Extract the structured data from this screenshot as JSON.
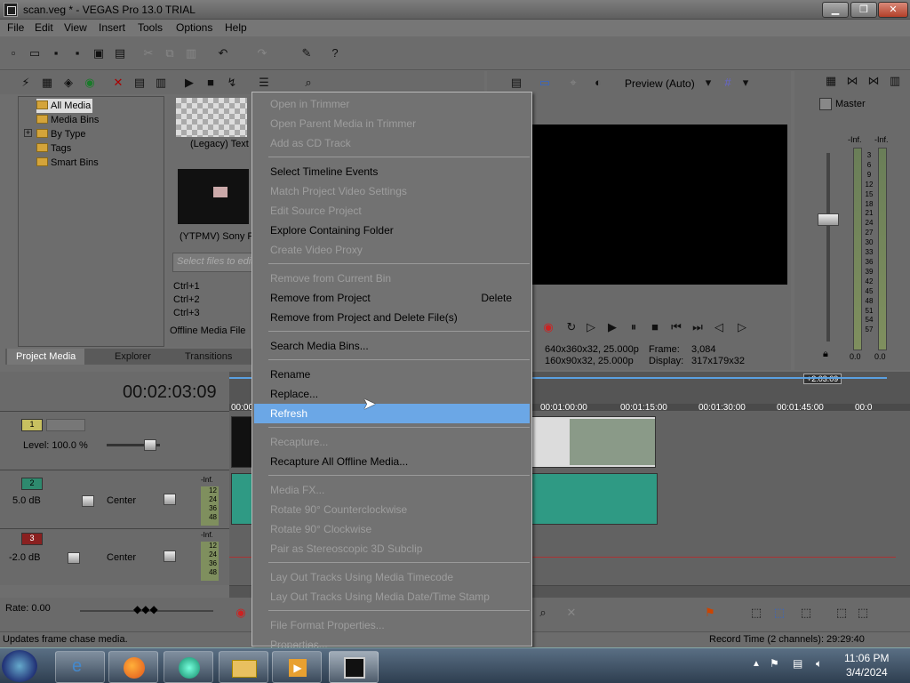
{
  "window": {
    "title": "scan.veg * - VEGAS Pro 13.0 TRIAL",
    "minimize": "▁",
    "maximize": "❐",
    "close": "✕"
  },
  "menu": [
    "File",
    "Edit",
    "View",
    "Insert",
    "Tools",
    "Options",
    "Help"
  ],
  "media_tree": {
    "items": [
      "All Media",
      "Media Bins",
      "By Type",
      "Tags",
      "Smart Bins"
    ],
    "expand": "+"
  },
  "media_thumbs": {
    "legacy_text": "(Legacy) Text",
    "ytpmv": "(YTPMV) Sony Pic",
    "search_placeholder": "Select files to edit",
    "shortcuts": [
      "Ctrl+1",
      "Ctrl+2",
      "Ctrl+3"
    ],
    "offline": "Offline Media File"
  },
  "tabs": [
    "Project Media",
    "Explorer",
    "Transitions"
  ],
  "preview": {
    "mode": "Preview (Auto)",
    "info_project": "640x360x32, 25.000p",
    "info_preview": "160x90x32, 25.000p",
    "frame_label": "Frame:",
    "frame_value": "3,084",
    "display_label": "Display:",
    "display_value": "317x179x32"
  },
  "master": {
    "label": "Master",
    "inf_l": "-Inf.",
    "inf_r": "-Inf.",
    "scale": [
      "3",
      "6",
      "9",
      "12",
      "15",
      "18",
      "21",
      "24",
      "27",
      "30",
      "33",
      "36",
      "39",
      "42",
      "45",
      "48",
      "51",
      "54",
      "57"
    ],
    "bottom_l": "0.0",
    "bottom_r": "0.0"
  },
  "timeline": {
    "timecode": "00:02:03:09",
    "marker": "+2:03:09",
    "ruler": [
      "00:00:00",
      "00:01:00:00",
      "00:01:15:00",
      "00:01:30:00",
      "00:01:45:00",
      "00:0"
    ]
  },
  "tracks": [
    {
      "num": "1",
      "level": "Level: 100.0 %"
    },
    {
      "num": "2",
      "vol": "5.0 dB",
      "pan": "Center",
      "inf": "-Inf.",
      "scale": [
        "12",
        "24",
        "36",
        "48"
      ]
    },
    {
      "num": "3",
      "vol": "-2.0 dB",
      "pan": "Center",
      "inf": "-Inf.",
      "scale": [
        "12",
        "24",
        "36",
        "48"
      ]
    }
  ],
  "rate": "Rate: 0.00",
  "status": {
    "left": "Updates frame chase media.",
    "right": "Record Time (2 channels): 29:29:40"
  },
  "context_menu": {
    "items": [
      {
        "label": "Open in Trimmer",
        "disabled": true
      },
      {
        "label": "Open Parent Media in Trimmer",
        "disabled": true
      },
      {
        "label": "Add as CD Track",
        "disabled": true
      },
      {
        "label": "Select Timeline Events",
        "disabled": false
      },
      {
        "label": "Match Project Video Settings",
        "disabled": true
      },
      {
        "label": "Edit Source Project",
        "disabled": true
      },
      {
        "label": "Explore Containing Folder",
        "disabled": false
      },
      {
        "label": "Create Video Proxy",
        "disabled": true
      },
      {
        "label": "Remove from Current Bin",
        "disabled": true
      },
      {
        "label": "Remove from Project",
        "disabled": false,
        "shortcut": "Delete"
      },
      {
        "label": "Remove from Project and Delete File(s)",
        "disabled": false
      },
      {
        "label": "Search Media Bins...",
        "disabled": false
      },
      {
        "label": "Rename",
        "disabled": false
      },
      {
        "label": "Replace...",
        "disabled": false
      },
      {
        "label": "Refresh",
        "disabled": false,
        "highlighted": true
      },
      {
        "label": "Recapture...",
        "disabled": true
      },
      {
        "label": "Recapture All Offline Media...",
        "disabled": false
      },
      {
        "label": "Media FX...",
        "disabled": true
      },
      {
        "label": "Rotate 90° Counterclockwise",
        "disabled": true
      },
      {
        "label": "Rotate 90° Clockwise",
        "disabled": true
      },
      {
        "label": "Pair as Stereoscopic 3D Subclip",
        "disabled": true
      },
      {
        "label": "Lay Out Tracks Using Media Timecode",
        "disabled": true
      },
      {
        "label": "Lay Out Tracks Using Media Date/Time Stamp",
        "disabled": true
      },
      {
        "label": "File Format Properties...",
        "disabled": true
      },
      {
        "label": "Properties...",
        "disabled": true
      }
    ]
  },
  "tray": {
    "time": "11:06 PM",
    "date": "3/4/2024"
  },
  "colors": {
    "highlight": "#6ba7e6",
    "clip_audio": "#2f9a84",
    "clip_video": "#8a9a88",
    "track2": "#2e8a6e",
    "track3": "#8a2020"
  }
}
